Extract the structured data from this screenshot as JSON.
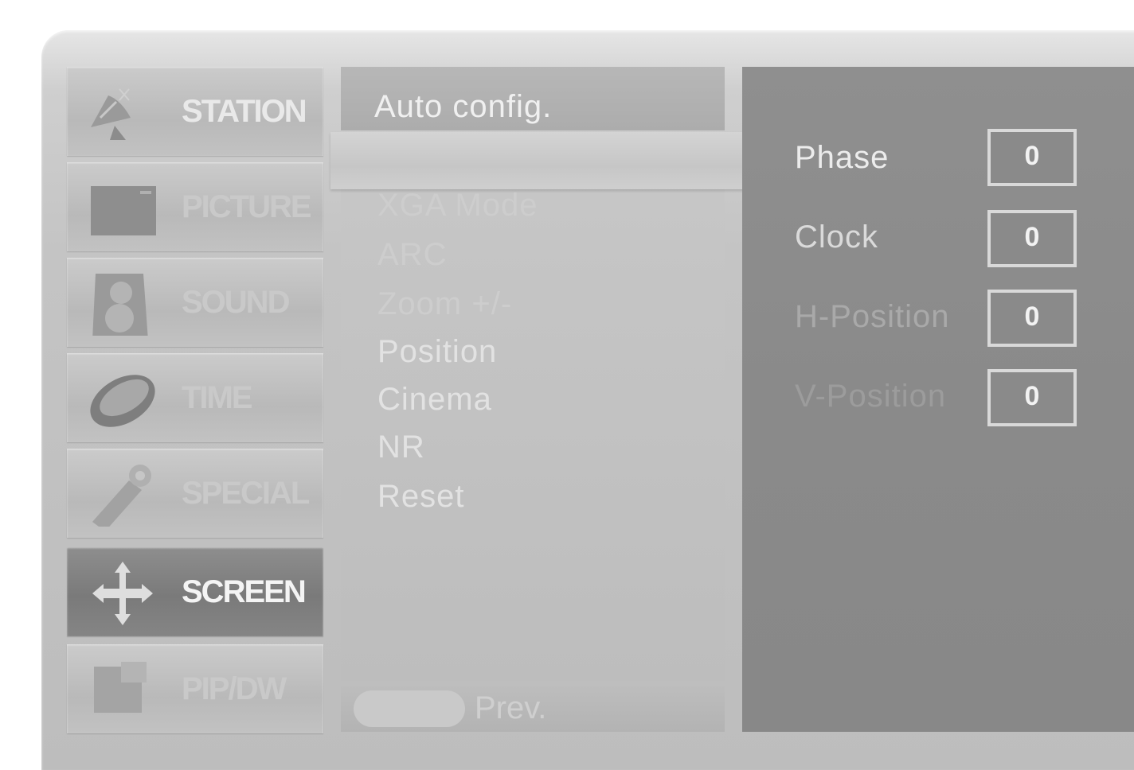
{
  "tabs": [
    {
      "label": "STATION",
      "icon": "satellite-dish-icon"
    },
    {
      "label": "PICTURE",
      "icon": "tv-screen-icon"
    },
    {
      "label": "SOUND",
      "icon": "speaker-icon"
    },
    {
      "label": "TIME",
      "icon": "clock-icon"
    },
    {
      "label": "SPECIAL",
      "icon": "wrench-icon"
    },
    {
      "label": "SCREEN",
      "icon": "move-arrows-icon"
    },
    {
      "label": "PIP/DW",
      "icon": "pip-window-icon"
    }
  ],
  "active_tab": "SCREEN",
  "menu": {
    "header": "Auto config.",
    "items": [
      "XGA Mode",
      "ARC",
      "Zoom +/-",
      "Position",
      "Cinema",
      "NR",
      "Reset"
    ]
  },
  "footer": {
    "prev_label": "Prev."
  },
  "params": [
    {
      "label": "Phase",
      "value": "0"
    },
    {
      "label": "Clock",
      "value": "0"
    },
    {
      "label": "H-Position",
      "value": "0"
    },
    {
      "label": "V-Position",
      "value": "0"
    }
  ],
  "colors": {
    "panel": "#c4c4c4",
    "active_tab": "#7a7a7a",
    "right_panel": "#8a8a8a",
    "text_light": "#e9e9e9"
  }
}
